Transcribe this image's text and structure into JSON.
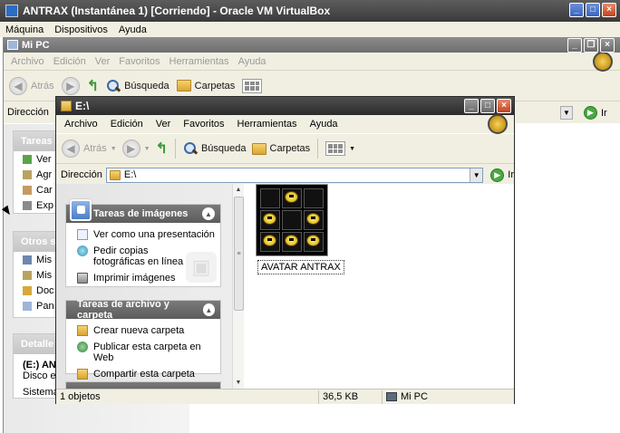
{
  "vbox": {
    "title": "ANTRAX (Instantánea 1) [Corriendo] - Oracle VM VirtualBox",
    "menu": [
      "Máquina",
      "Dispositivos",
      "Ayuda"
    ]
  },
  "mipc": {
    "title": "Mi PC",
    "menu": [
      "Archivo",
      "Edición",
      "Ver",
      "Favoritos",
      "Herramientas",
      "Ayuda"
    ],
    "back": "Atrás",
    "search": "Búsqueda",
    "folders": "Carpetas",
    "address_label": "Dirección",
    "go": "Ir",
    "panels": [
      {
        "title": "Tareas",
        "items": [
          "Ver",
          "Agr",
          "Car",
          "Exp"
        ]
      },
      {
        "title": "Otros s",
        "items": [
          "Mis",
          "Mis",
          "Doc",
          "Pan"
        ]
      },
      {
        "title": "Detalle",
        "lines": [
          "(E:) ANT",
          "Disco ex",
          "Sistema"
        ]
      }
    ]
  },
  "win": {
    "title": "E:\\",
    "menu": [
      "Archivo",
      "Edición",
      "Ver",
      "Favoritos",
      "Herramientas",
      "Ayuda"
    ],
    "toolbar": {
      "back": "Atrás",
      "search": "Búsqueda",
      "folders": "Carpetas"
    },
    "address": {
      "label": "Dirección",
      "value": "E:\\",
      "go": "Ir"
    },
    "panels": [
      {
        "title": "Tareas de imágenes",
        "items": [
          "Ver como una presentación",
          "Pedir copias fotográficas en línea",
          "Imprimir imágenes"
        ]
      },
      {
        "title": "Tareas de archivo y carpeta",
        "items": [
          "Crear nueva carpeta",
          "Publicar esta carpeta en Web",
          "Compartir esta carpeta"
        ]
      }
    ],
    "file": {
      "name": "AVATAR ANTRAX"
    },
    "status": {
      "objects": "1 objetos",
      "size": "36,5 KB",
      "location": "Mi PC"
    }
  }
}
